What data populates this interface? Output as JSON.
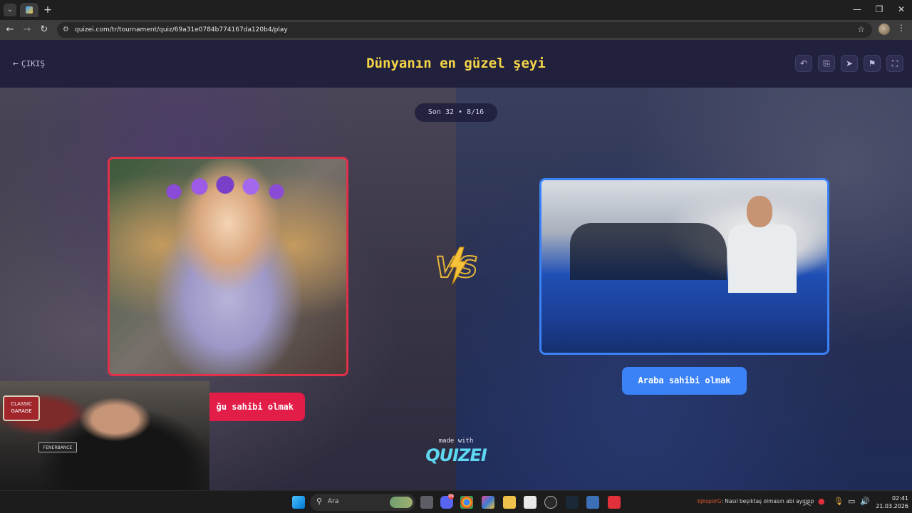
{
  "browser": {
    "url": "quizei.com/tr/tournament/quiz/69a31e0784b774167da120b4/play",
    "new_tab": "+",
    "min": "—",
    "max": "❐",
    "close": "✕"
  },
  "header": {
    "exit_label": "ÇIKIŞ",
    "title": "Dünyanın en güzel şeyi"
  },
  "round": "Son 32 • 8/16",
  "options": {
    "left_label": "ğu sahibi olmak",
    "right_label": "Araba sahibi olmak"
  },
  "footer": {
    "made_with": "made with",
    "brand": "QUIZEI"
  },
  "webcam": {
    "sign1": "CLASSIC GARAGE",
    "sign2": "FENERBANCE"
  },
  "taskbar": {
    "search_placeholder": "Ara",
    "discord_badge": "99",
    "ticker_user": "bjksporG",
    "ticker_text": ": Nasıl beşiktaş olmasın abi ayıppp",
    "time": "02:41",
    "date": "21.03.2026"
  },
  "colors": {
    "title": "#f5d548",
    "left_accent": "#e11d48",
    "right_accent": "#3b82f6",
    "brand": "#5ed7f0"
  }
}
